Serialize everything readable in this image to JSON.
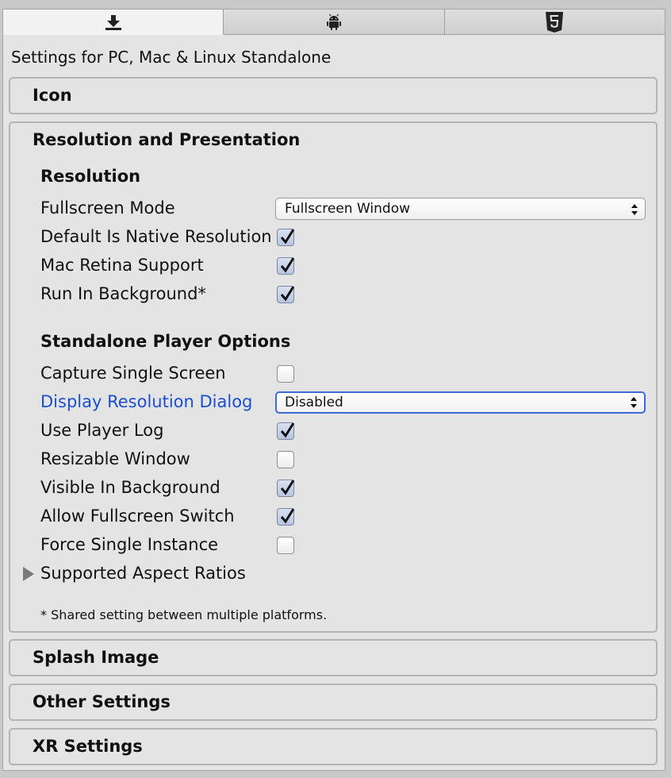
{
  "tabs": [
    {
      "icon": "standalone-download-icon",
      "active": true
    },
    {
      "icon": "android-icon",
      "active": false
    },
    {
      "icon": "html5-icon",
      "active": false
    }
  ],
  "settings_title": "Settings for PC, Mac & Linux Standalone",
  "sections": {
    "icon": {
      "title": "Icon"
    },
    "resolution": {
      "title": "Resolution and Presentation",
      "resolution_header": "Resolution",
      "fullscreen_mode": {
        "label": "Fullscreen Mode",
        "value": "Fullscreen Window"
      },
      "default_native": {
        "label": "Default Is Native Resolution",
        "checked": true
      },
      "mac_retina": {
        "label": "Mac Retina Support",
        "checked": true
      },
      "run_in_background": {
        "label": "Run In Background*",
        "checked": true
      },
      "standalone_header": "Standalone Player Options",
      "capture_single_screen": {
        "label": "Capture Single Screen",
        "checked": false
      },
      "display_resolution_dialog": {
        "label": "Display Resolution Dialog",
        "value": "Disabled"
      },
      "use_player_log": {
        "label": "Use Player Log",
        "checked": true
      },
      "resizable_window": {
        "label": "Resizable Window",
        "checked": false
      },
      "visible_in_background": {
        "label": "Visible In Background",
        "checked": true
      },
      "allow_fullscreen_switch": {
        "label": "Allow Fullscreen Switch",
        "checked": true
      },
      "force_single_instance": {
        "label": "Force Single Instance",
        "checked": false
      },
      "supported_aspect_ratios": {
        "label": "Supported Aspect Ratios",
        "expanded": false
      },
      "footnote": "* Shared setting between multiple platforms."
    },
    "splash": {
      "title": "Splash Image"
    },
    "other": {
      "title": "Other Settings"
    },
    "xr": {
      "title": "XR Settings"
    }
  },
  "colors": {
    "panel_bg": "#e4e4e4",
    "highlight_label": "#1a4fd1",
    "focus_border": "#3d6ad8",
    "checkbox_checked": "#b8c6e0"
  }
}
